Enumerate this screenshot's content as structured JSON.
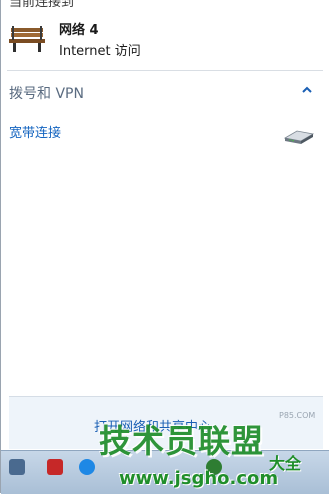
{
  "top_clipped_text": "当前连接到",
  "network": {
    "name": "网络 4",
    "access": "Internet 访问",
    "icon": "bench-icon"
  },
  "dialup_section": {
    "title": "拨号和 VPN",
    "icon": "chevron-up-icon",
    "connections": [
      {
        "name": "宽带连接",
        "icon": "modem-icon"
      }
    ]
  },
  "footer": {
    "link": "打开网络和共享中心"
  },
  "watermark": {
    "main": "技术员联盟",
    "sub": "大全",
    "url": "www.jsgho.com",
    "mini": "P85.COM"
  },
  "colors": {
    "link": "#1565c0",
    "section_title": "#5a6b80",
    "watermark": "#1f8e2a",
    "footer_bg": "#eef4fa"
  }
}
